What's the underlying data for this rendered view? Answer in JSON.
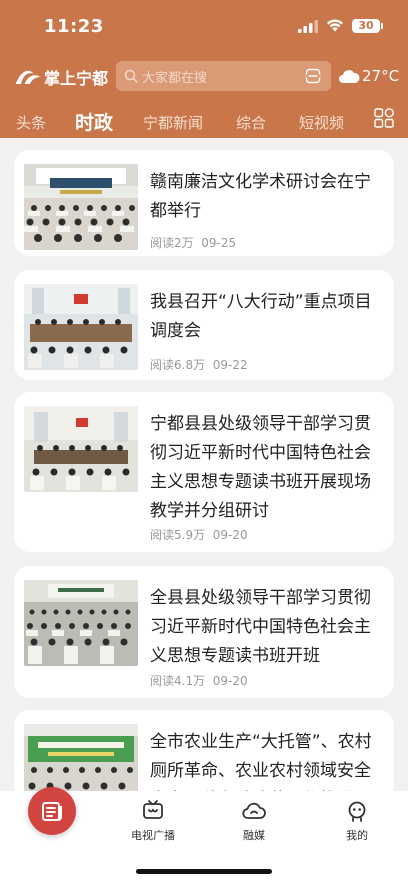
{
  "status_bar": {
    "time": "11:23",
    "battery": "30"
  },
  "header": {
    "logo_text": "掌上宁都",
    "search_placeholder": "大家都在搜",
    "temperature": "27°C"
  },
  "tabs": [
    {
      "label": "头条",
      "active": false
    },
    {
      "label": "时政",
      "active": true
    },
    {
      "label": "宁都新闻",
      "active": false
    },
    {
      "label": "综合",
      "active": false
    },
    {
      "label": "短视频",
      "active": false
    }
  ],
  "articles": [
    {
      "title": "赣南廉洁文化学术研讨会在宁都举行",
      "reads": "阅读2万",
      "date": "09-25"
    },
    {
      "title": "我县召开“八大行动”重点项目调度会",
      "reads": "阅读6.8万",
      "date": "09-22"
    },
    {
      "title": "宁都县县处级领导干部学习贯彻习近平新时代中国特色社会主义思想专题读书班开展现场教学并分组研讨",
      "reads": "阅读5.9万",
      "date": "09-20"
    },
    {
      "title": "全县县处级领导干部学习贯彻习近平新时代中国特色社会主义思想专题读书班开班",
      "reads": "阅读4.1万",
      "date": "09-20"
    },
    {
      "title": "全市农业生产“大托管”、农村厕所革命、农业农村领域安全生产暨秋冬种冲草工作推进",
      "reads": "",
      "date": ""
    }
  ],
  "bottom_nav": {
    "tv": "电视广播",
    "media": "融媒",
    "mine": "我的"
  },
  "colors": {
    "brand": "#c9764a",
    "home_button": "#d2443f"
  }
}
